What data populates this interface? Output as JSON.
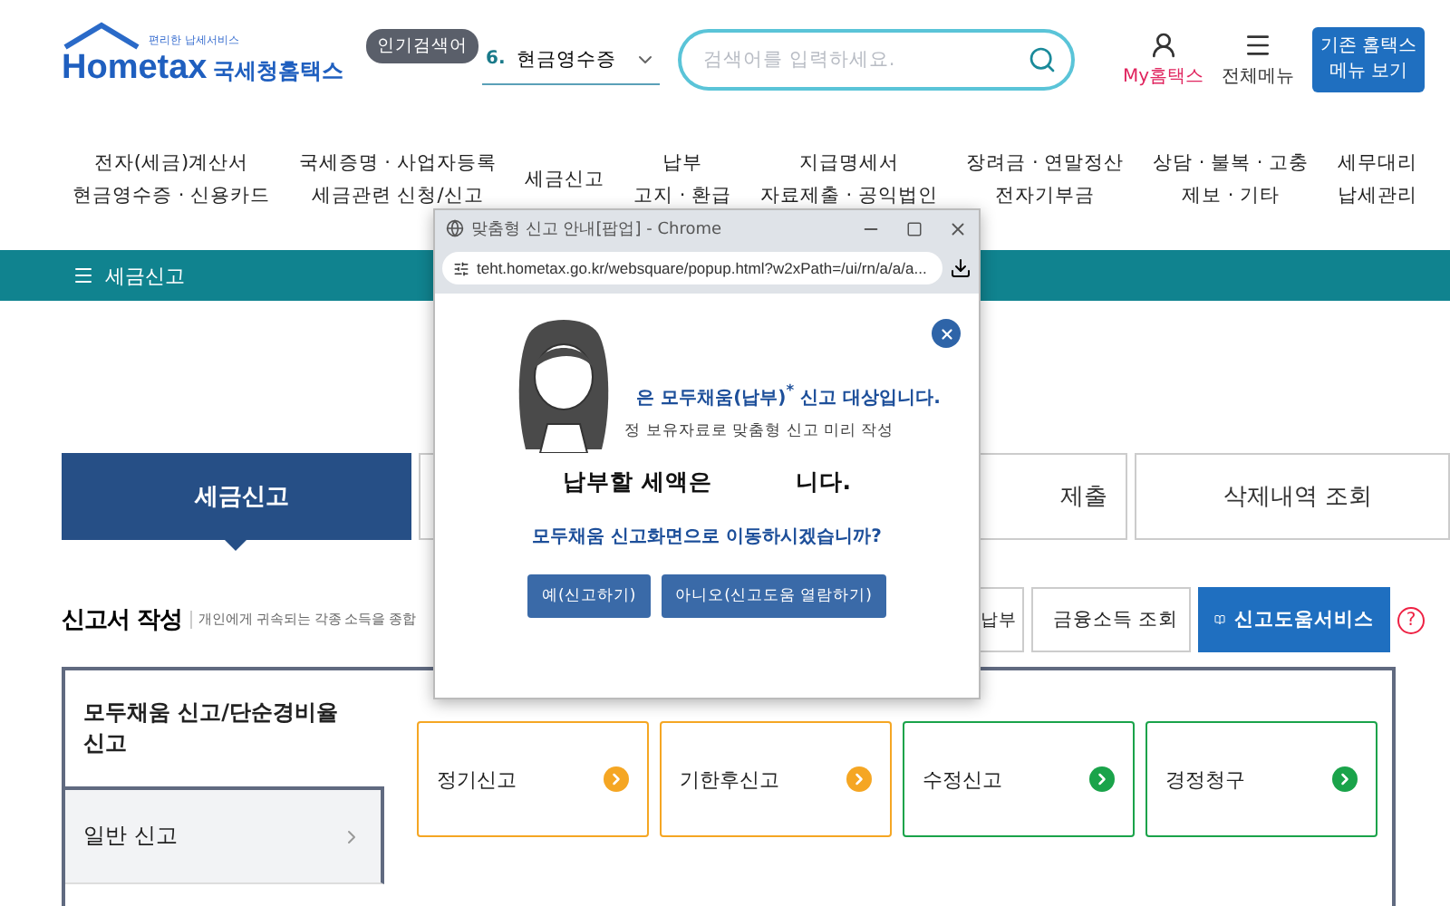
{
  "header": {
    "logo": {
      "small": "편리한 납세서비스",
      "brand": "Hometax",
      "name": "국세청홈택스"
    },
    "popular_badge": "인기검색어",
    "popular_select": {
      "rank": "6.",
      "value": "현금영수증"
    },
    "search": {
      "placeholder": "검색어를 입력하세요."
    },
    "my_link": "My홈택스",
    "menu_link": "전체메뉴",
    "legacy_button": "기존 홈택스 메뉴 보기"
  },
  "nav": [
    {
      "lines": [
        "전자(세금)계산서",
        "현금영수증 · 신용카드"
      ]
    },
    {
      "lines": [
        "국세증명 · 사업자등록",
        "세금관련 신청/신고"
      ]
    },
    {
      "lines": [
        "세금신고"
      ]
    },
    {
      "lines": [
        "납부",
        "고지 · 환급"
      ]
    },
    {
      "lines": [
        "지급명세서",
        "자료제출 · 공익법인"
      ]
    },
    {
      "lines": [
        "장려금 · 연말정산",
        "전자기부금"
      ]
    },
    {
      "lines": [
        "상담 · 불복 · 고충",
        "제보 · 기타"
      ]
    },
    {
      "lines": [
        "세무대리",
        "납세관리"
      ]
    }
  ],
  "section_bar": {
    "title": "세금신고"
  },
  "tabs": [
    {
      "label": "세금신고",
      "selected": true
    },
    {
      "selected": false
    },
    {
      "label": "제출",
      "selected": false
    },
    {
      "label": "삭제내역 조회",
      "selected": false
    }
  ],
  "form_heading": {
    "title": "신고서 작성",
    "description": "개인에게 귀속되는 각종 소득을 종합",
    "help": "?"
  },
  "actions": [
    {
      "label": "납부",
      "kind": "plain"
    },
    {
      "label": "금융소득 조회",
      "kind": "check"
    },
    {
      "label": "신고도움서비스",
      "kind": "primary"
    }
  ],
  "side_menu": [
    {
      "label": "모두채움 신고/단순경비율 신고",
      "selected": true
    },
    {
      "label": "일반 신고",
      "selected": false
    }
  ],
  "cards": [
    {
      "label": "정기신고",
      "color": "#f5a623"
    },
    {
      "label": "기한후신고",
      "color": "#f5a623"
    },
    {
      "label": "수정신고",
      "color": "#1aa34a"
    },
    {
      "label": "경정청구",
      "color": "#1aa34a"
    }
  ],
  "popup": {
    "window_title": "맞춤형 신고 안내[팝업] - Chrome",
    "url": "teht.hometax.go.kr/websquare/popup.html?w2xPath=/ui/rn/a/a/a...",
    "line_1": "은 모두채움(납부)$^{*}$ 신고 대상입니다.",
    "line_2": "정 보유자료로 맞춤형 신고 미리 작성",
    "amount_before": "납부할 세액은",
    "amount_after": "니다.",
    "question": "모두채움 신고화면으로 이동하시겠습니까?",
    "buttons": [
      "예(신고하기)",
      "아니오(신고도움 열람하기)"
    ]
  }
}
